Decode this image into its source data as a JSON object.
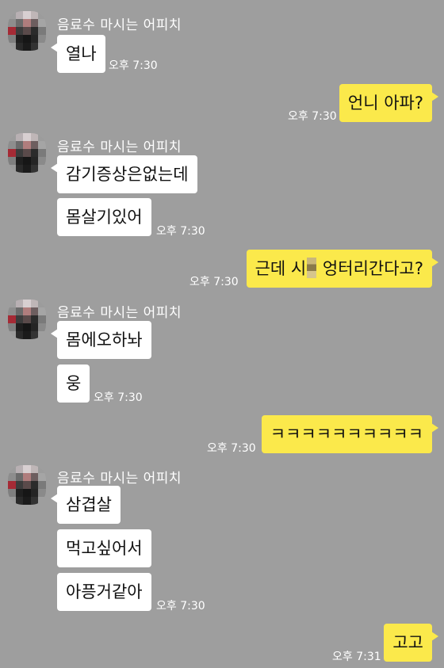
{
  "sender_name": "음료수 마시는 어피치",
  "colors": {
    "background": "#9e9e9e",
    "incoming_bubble": "#ffffff",
    "outgoing_bubble": "#fbe94b"
  },
  "messages": {
    "m1": {
      "text": "열나",
      "time": "오후 7:30"
    },
    "m2": {
      "text": "언니 아파?",
      "time": "오후 7:30"
    },
    "m3": {
      "text": "감기증상은없는데"
    },
    "m4": {
      "text": "몸살기있어",
      "time": "오후 7:30"
    },
    "m5": {
      "text_before": "근데 시",
      "text_after": " 엉터리간다고?",
      "time": "오후 7:30"
    },
    "m6": {
      "text": "몸에오하놔"
    },
    "m7": {
      "text": "웅",
      "time": "오후 7:30"
    },
    "m8": {
      "text": "ㅋㅋㅋㅋㅋㅋㅋㅋㅋㅋ",
      "time": "오후 7:30"
    },
    "m9": {
      "text": "삼겹살"
    },
    "m10": {
      "text": "먹고싶어서"
    },
    "m11": {
      "text": "아픙거같아",
      "time": "오후 7:30"
    },
    "m12": {
      "text": "고고",
      "time": "오후 7:31"
    }
  }
}
